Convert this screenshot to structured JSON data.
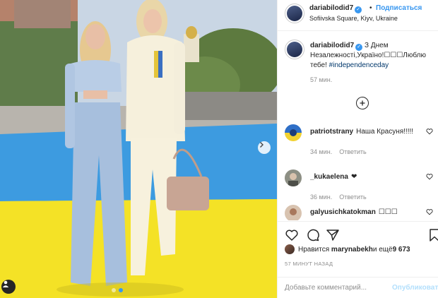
{
  "header": {
    "username": "dariabilodid7",
    "follow_separator": "•",
    "follow_label": "Подписаться",
    "location": "Sofiivska Square, Kiyv, Ukraine"
  },
  "caption": {
    "username": "dariabilodid7",
    "text": "З Днем Незалежності,Україно!☐☐☐Люблю тебе! ",
    "hashtag": "#independenceday",
    "time": "57 мин."
  },
  "comments": [
    {
      "username": "patriotstrany",
      "text": "Наша Красуня!!!!!",
      "time": "34 мин.",
      "reply": "Ответить"
    },
    {
      "username": "_kukaelena",
      "text": "❤",
      "time": "36 мин.",
      "reply": "Ответить"
    },
    {
      "username": "galyusichkatokman",
      "text": "☐☐☐",
      "time": "",
      "reply": ""
    }
  ],
  "likes": {
    "prefix": "Нравится",
    "user": "marynabekh",
    "middle": " и ещё ",
    "count": "9 673"
  },
  "post_date": "57 МИНУТ НАЗАД",
  "add_comment": {
    "placeholder": "Добавьте комментарий...",
    "post_label": "Опубликовать"
  },
  "icons": {
    "verified": "verified-badge-icon",
    "like": "heart-icon",
    "comment": "comment-icon",
    "share": "paper-plane-icon",
    "save": "bookmark-icon",
    "load_more": "plus-circle-icon",
    "next": "chevron-right-icon",
    "tags": "user-tag-icon"
  },
  "colors": {
    "accent": "#3897f0",
    "text": "#262626",
    "muted": "#8e8e8e",
    "hashtag": "#00376b",
    "post_disabled": "#b2dffc"
  },
  "carousel": {
    "slides": 2,
    "active_index": 1
  }
}
